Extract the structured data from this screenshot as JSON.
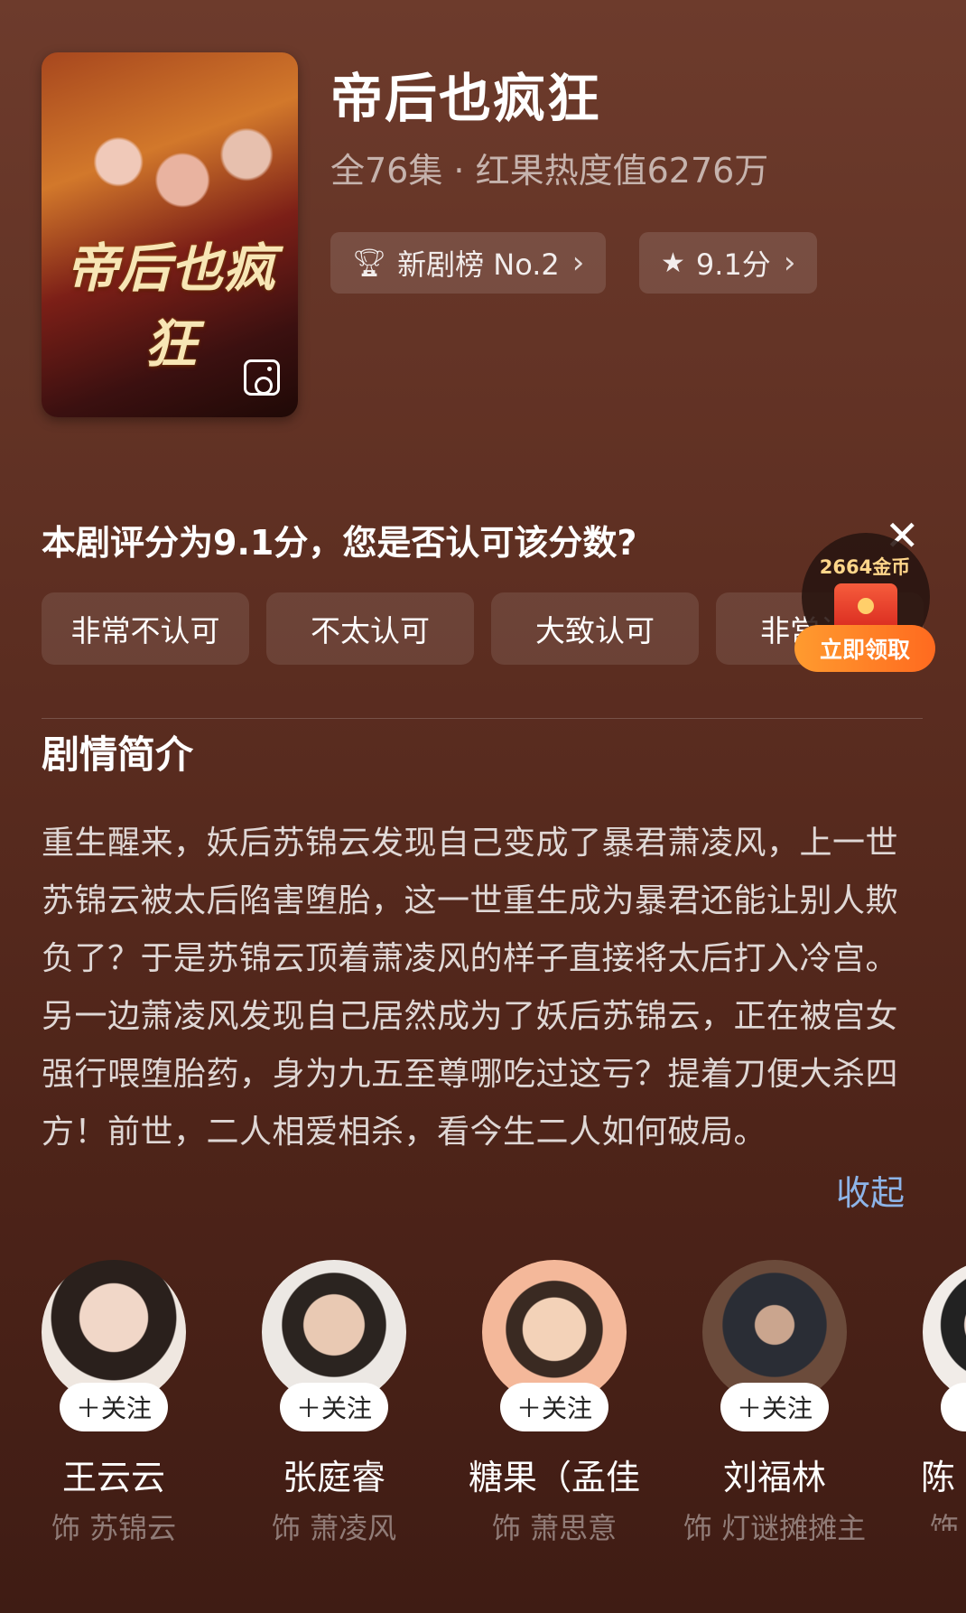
{
  "drama": {
    "poster_title": "帝后也疯狂",
    "title": "帝后也疯狂",
    "meta": "全76集 · 红果热度值6276万"
  },
  "badges": {
    "rank_label": "新剧榜 No.2",
    "score_label": "9.1分"
  },
  "rating_prompt": {
    "question": "本剧评分为9.1分，您是否认可该分数?",
    "options": [
      "非常不认可",
      "不太认可",
      "大致认可",
      "非常认可"
    ]
  },
  "reward": {
    "coins": "2664金币",
    "button": "立即领取"
  },
  "synopsis": {
    "heading": "剧情简介",
    "text": "重生醒来，妖后苏锦云发现自己变成了暴君萧凌风，上一世苏锦云被太后陷害堕胎，这一世重生成为暴君还能让别人欺负了？于是苏锦云顶着萧凌风的样子直接将太后打入冷宫。另一边萧凌风发现自己居然成为了妖后苏锦云，正在被宫女强行喂堕胎药，身为九五至尊哪吃过这亏？提着刀便大杀四方！前世，二人相爱相杀，看今生二人如何破局。",
    "collapse_label": "收起"
  },
  "cast": [
    {
      "name": "王云云",
      "role": "饰 苏锦云",
      "follow": "＋关注"
    },
    {
      "name": "张庭睿",
      "role": "饰 萧凌风",
      "follow": "＋关注"
    },
    {
      "name": "糖果（孟佳",
      "role": "饰 萧思意",
      "follow": "＋关注"
    },
    {
      "name": "刘福林",
      "role": "饰 灯谜摊摊主",
      "follow": "＋关注"
    },
    {
      "name": "陈",
      "role": "饰",
      "follow": "＋"
    }
  ],
  "icons": {
    "rank": "trophy-icon",
    "score": "star-icon",
    "close": "close-icon",
    "poster": "gallery-icon"
  }
}
